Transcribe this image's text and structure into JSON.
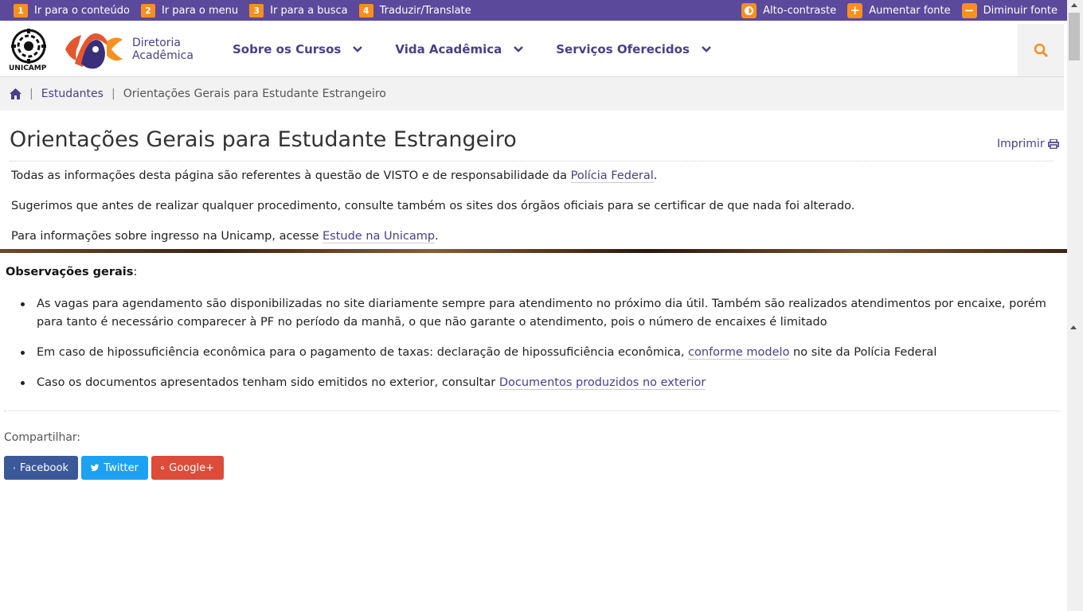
{
  "access_bar": {
    "left": [
      {
        "num": "1",
        "label": "Ir para o conteúdo"
      },
      {
        "num": "2",
        "label": "Ir para o menu"
      },
      {
        "num": "3",
        "label": "Ir para a busca"
      },
      {
        "num": "4",
        "label": "Traduzir/Translate"
      }
    ],
    "right": [
      {
        "icon": "contrast-icon",
        "label": "Alto-contraste"
      },
      {
        "icon": "plus-icon",
        "label": "Aumentar fonte"
      },
      {
        "icon": "minus-icon",
        "label": "Diminuir fonte"
      }
    ]
  },
  "header": {
    "unicamp_text": "UNICAMP",
    "org_line1": "Diretoria",
    "org_line2": "Acadêmica",
    "nav": [
      "Sobre os Cursos",
      "Vida Acadêmica",
      "Serviços Oferecidos"
    ]
  },
  "breadcrumb": {
    "items": [
      "Estudantes",
      "Orientações Gerais para Estudante Estrangeiro"
    ]
  },
  "content": {
    "title": "Orientações Gerais para Estudante Estrangeiro",
    "print_label": "Imprimir",
    "para1_text": "Todas as informações desta página são referentes à questão de VISTO e de responsabilidade da ",
    "para1_link": "Polícia Federal",
    "para1_end": ".",
    "para2": "Sugerimos que antes de realizar qualquer procedimento, consulte também os sites dos órgãos oficiais para se certificar de que nada foi alterado.",
    "para3_text": "Para informações sobre ingresso na Unicamp, acesse ",
    "para3_link": "Estude na Unicamp",
    "para3_end": ".",
    "obs_title": "Observações gerais",
    "obs_colon": ":",
    "obs_items": [
      {
        "text": "As vagas para agendamento são disponibilizadas no site diariamente sempre para atendimento no próximo dia útil. Também são realizados atendimentos por encaixe, porém para tanto é necessário comparecer à PF no período da manhã, o que não garante o atendimento, pois o número de encaixes é limitado",
        "link": "",
        "after": ""
      },
      {
        "text": "Em caso de hipossuficiência econômica para o pagamento de taxas: declaração de hipossuficiência econômica, ",
        "link": "conforme modelo",
        "after": " no site da Polícia Federal"
      },
      {
        "text": "Caso os documentos apresentados tenham sido emitidos no exterior, consultar ",
        "link": "Documentos produzidos no exterior",
        "after": ""
      }
    ]
  },
  "share": {
    "label": "Compartilhar:",
    "buttons": [
      "Facebook",
      "Twitter",
      "Google+"
    ]
  },
  "colors": {
    "brand_purple": "#5b4a9b",
    "accent_orange": "#f7901e",
    "facebook": "#3b5998",
    "twitter": "#1da1f2",
    "google": "#dd4b39"
  }
}
